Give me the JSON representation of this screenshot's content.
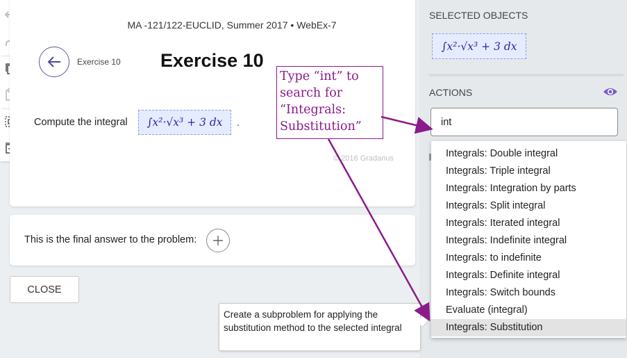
{
  "toolbar": {
    "tools": [
      {
        "icon": "undo-icon"
      },
      {
        "icon": "redo-icon"
      },
      {
        "icon": "copy-icon"
      },
      {
        "icon": "paste-icon"
      },
      {
        "icon": "select-all-icon"
      },
      {
        "icon": "add-box-icon"
      }
    ]
  },
  "exercise": {
    "course_title": "MA -121/122-EUCLID, Summer 2017 • WebEx-7",
    "breadcrumb": "Exercise 10",
    "heading": "Exercise 10",
    "prompt": "Compute the integral",
    "integral": "∫x²·√x³ + 3 dx",
    "period": ".",
    "copyright": "© 2016 Gradarius"
  },
  "answer": {
    "text": "This is the final answer to the problem:"
  },
  "close_label": "CLOSE",
  "panel": {
    "selected_label": "SELECTED OBJECTS",
    "selected_integral": "∫x²·√x³ + 3 dx",
    "actions_label": "ACTIONS",
    "search_value": "int"
  },
  "suggestions": [
    "Integrals: Double integral",
    "Integrals: Triple integral",
    "Integrals: Integration by parts",
    "Integrals: Split integral",
    "Integrals: Iterated integral",
    "Integrals: Indefinite integral",
    "Integrals: to indefinite",
    "Integrals: Definite integral",
    "Integrals: Switch bounds",
    "Evaluate (integral)",
    "Integrals: Substitution"
  ],
  "highlighted_suggestion": "Integrals: Substitution",
  "annotation": {
    "text": "Type “int” to search for “Integrals: Substitution”",
    "color": "#8b1a8b"
  },
  "tooltip": {
    "text": "Create a subproblem for applying the substitution method to the selected integral"
  },
  "colors": {
    "math_text": "#2a2aa8",
    "math_bg": "#e6ecff",
    "accent_back": "#5a5a96",
    "annotation": "#8b1a8b",
    "eye": "#7a5ac8"
  }
}
